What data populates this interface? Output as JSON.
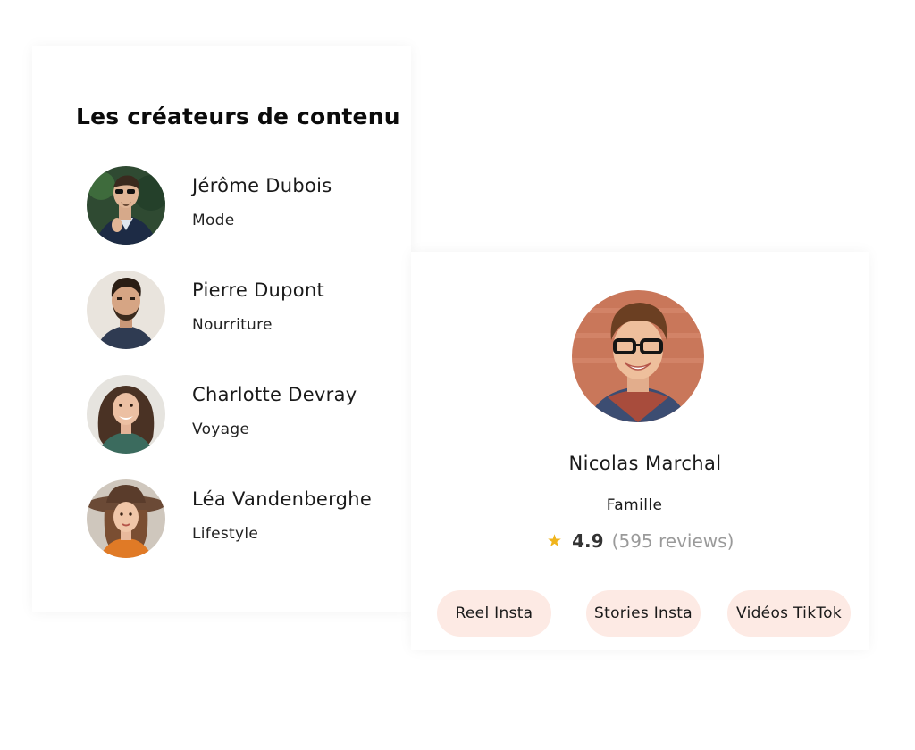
{
  "creators_panel": {
    "title": "Les créateurs de contenu",
    "creators": [
      {
        "name": "Jérôme Dubois",
        "category": "Mode"
      },
      {
        "name": "Pierre Dupont",
        "category": "Nourriture"
      },
      {
        "name": "Charlotte Devray",
        "category": "Voyage"
      },
      {
        "name": "Léa Vandenberghe",
        "category": "Lifestyle"
      }
    ]
  },
  "profile_card": {
    "name": "Nicolas Marchal",
    "category": "Famille",
    "rating": "4.9",
    "reviews": "(595 reviews)",
    "rating_stars": 1,
    "star_icon": "star-icon",
    "star_color": "#f0b41c",
    "services": [
      "Reel Insta",
      "Stories Insta",
      "Vidéos TikTok"
    ],
    "pill_color": "#fdeae4"
  }
}
